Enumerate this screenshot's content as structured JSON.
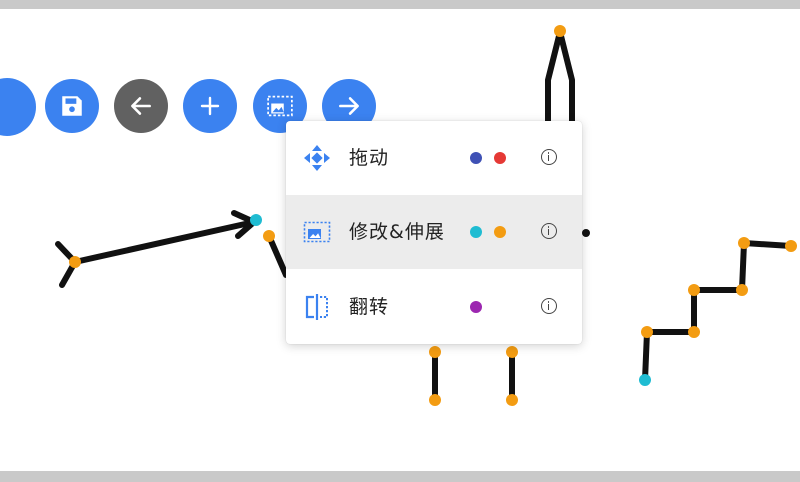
{
  "toolbar": {
    "buttons": [
      {
        "name": "primary",
        "icon": "circle-icon",
        "color": "#3b82f0"
      },
      {
        "name": "save",
        "icon": "save-icon",
        "color": "#3b82f0"
      },
      {
        "name": "back",
        "icon": "arrow-left-icon",
        "color": "#616161"
      },
      {
        "name": "add",
        "icon": "plus-icon",
        "color": "#3b82f0"
      },
      {
        "name": "image-modify",
        "icon": "image-select-icon",
        "color": "#3b82f0"
      },
      {
        "name": "forward",
        "icon": "arrow-right-icon",
        "color": "#3b82f0"
      }
    ]
  },
  "menu": {
    "items": [
      {
        "label": "拖动",
        "icon": "move-icon",
        "colors": [
          "#3f51b5",
          "#e53935"
        ],
        "active": false
      },
      {
        "label": "修改&伸展",
        "icon": "image-select-icon",
        "colors": [
          "#1fbcd2",
          "#f39c12"
        ],
        "active": true
      },
      {
        "label": "翻转",
        "icon": "flip-icon",
        "colors": [
          "#9c27b0"
        ],
        "active": false
      }
    ]
  },
  "colors": {
    "accent": "#3b82f0",
    "joint_orange": "#f39c12",
    "joint_cyan": "#1fbcd2",
    "stroke": "#111111"
  }
}
